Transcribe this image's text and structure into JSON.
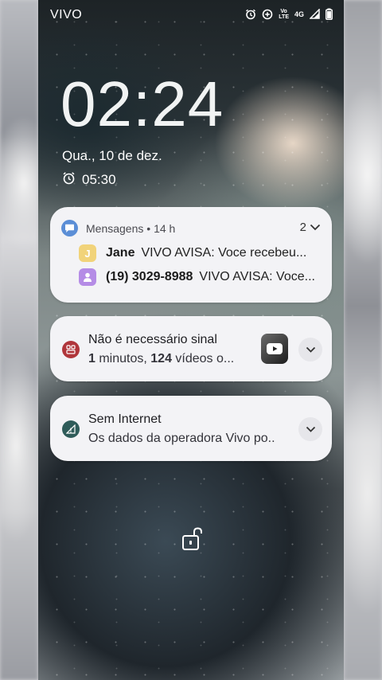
{
  "status_bar": {
    "carrier": "VIVO",
    "icons": [
      "alarm-icon",
      "data-saver-icon",
      "volte-icon",
      "4g-icon",
      "signal-icon",
      "battery-icon"
    ],
    "volte_line1": "Vo",
    "volte_line2": "LTE",
    "network": "4G"
  },
  "lockscreen": {
    "time": "02:24",
    "date": "Qua., 10 de dez.",
    "alarm_time": "05:30"
  },
  "notifications": {
    "messages": {
      "app": "Mensagens",
      "meta": "• 14 h",
      "count": "2",
      "items": [
        {
          "avatar_letter": "J",
          "sender": "Jane",
          "text": "VIVO AVISA: Voce recebeu"
        },
        {
          "avatar_letter": "",
          "sender": "(19) 3029-8988",
          "text": "VIVO AVISA: Voce"
        }
      ]
    },
    "signal": {
      "title": "Não é necessário sinal",
      "body_num1": "1",
      "body_mid": " minutos, ",
      "body_num2": "124",
      "body_tail": " vídeos o..."
    },
    "internet": {
      "title": "Sem Internet",
      "body": "Os dados da operadora Vivo po.."
    }
  },
  "colors": {
    "card_bg": "#f3f3f6",
    "messages_icon": "#5b8ed6",
    "jane_avatar": "#f1d37a",
    "contact_avatar": "#b58ce6",
    "signal_icon": "#b0363b",
    "internet_icon": "#2f5c5a"
  }
}
